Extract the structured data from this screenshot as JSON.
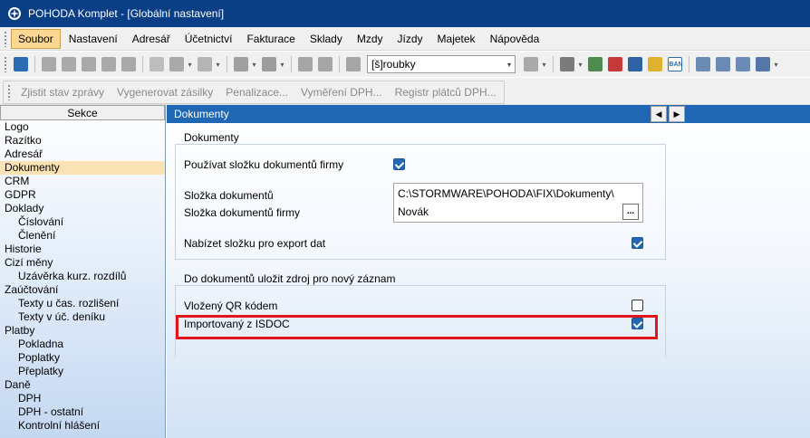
{
  "window": {
    "title": "POHODA Komplet - [Globální nastavení]",
    "icon": "pohoda-app-icon"
  },
  "menu": {
    "items": [
      {
        "label": "Soubor",
        "active": true
      },
      {
        "label": "Nastavení"
      },
      {
        "label": "Adresář"
      },
      {
        "label": "Účetnictví"
      },
      {
        "label": "Fakturace"
      },
      {
        "label": "Sklady"
      },
      {
        "label": "Mzdy"
      },
      {
        "label": "Jízdy"
      },
      {
        "label": "Majetek"
      },
      {
        "label": "Nápověda"
      }
    ]
  },
  "toolbar": {
    "search_combo_value": "[š]roubky",
    "iban_label": "IBAN"
  },
  "toolbar2": {
    "buttons": [
      "Zjistit stav zprávy",
      "Vygenerovat zásilky",
      "Penalizace...",
      "Vyměření DPH...",
      "Registr plátců DPH..."
    ]
  },
  "sections": {
    "header": "Sekce",
    "items": [
      {
        "label": "Logo",
        "level": 0
      },
      {
        "label": "Razítko",
        "level": 0
      },
      {
        "label": "Adresář",
        "level": 0
      },
      {
        "label": "Dokumenty",
        "level": 0,
        "selected": true
      },
      {
        "label": "CRM",
        "level": 0
      },
      {
        "label": "GDPR",
        "level": 0
      },
      {
        "label": "Doklady",
        "level": 0
      },
      {
        "label": "Číslování",
        "level": 1
      },
      {
        "label": "Členění",
        "level": 1
      },
      {
        "label": "Historie",
        "level": 0
      },
      {
        "label": "Cizí měny",
        "level": 0
      },
      {
        "label": "Uzávěrka kurz. rozdílů",
        "level": 1
      },
      {
        "label": "Zaúčtování",
        "level": 0
      },
      {
        "label": "Texty u čas. rozlišení",
        "level": 1
      },
      {
        "label": "Texty v úč. deníku",
        "level": 1
      },
      {
        "label": "Platby",
        "level": 0
      },
      {
        "label": "Pokladna",
        "level": 1
      },
      {
        "label": "Poplatky",
        "level": 1
      },
      {
        "label": "Přeplatky",
        "level": 1
      },
      {
        "label": "Daně",
        "level": 0
      },
      {
        "label": "DPH",
        "level": 1
      },
      {
        "label": "DPH - ostatní",
        "level": 1
      },
      {
        "label": "Kontrolní hlášení",
        "level": 1
      }
    ]
  },
  "panel": {
    "title": "Dokumenty",
    "group1": {
      "title": "Dokumenty",
      "use_company_folder": {
        "label": "Používat složku dokumentů firmy",
        "checked": true
      },
      "doc_folder_label": "Složka dokumentů",
      "company_folder_label": "Složka dokumentů firmy",
      "doc_folder_value": "C:\\STORMWARE\\POHODA\\FIX\\Dokumenty\\",
      "company_folder_value": "Novák",
      "browse_label": "...",
      "offer_export_folder": {
        "label": "Nabízet složku pro export dat",
        "checked": true
      }
    },
    "group2": {
      "title": "Do dokumentů uložit zdroj pro nový záznam",
      "qr_source": {
        "label": "Vložený QR kódem",
        "checked": false
      },
      "isdoc_source": {
        "label": "Importovaný z ISDOC",
        "checked": true
      }
    }
  },
  "colors": {
    "titlebar": "#0a3f86",
    "panel_header": "#1f66b3",
    "selected_item": "#fbe3b5",
    "highlight": "#e3151b",
    "checkbox_on": "#2368b4"
  }
}
